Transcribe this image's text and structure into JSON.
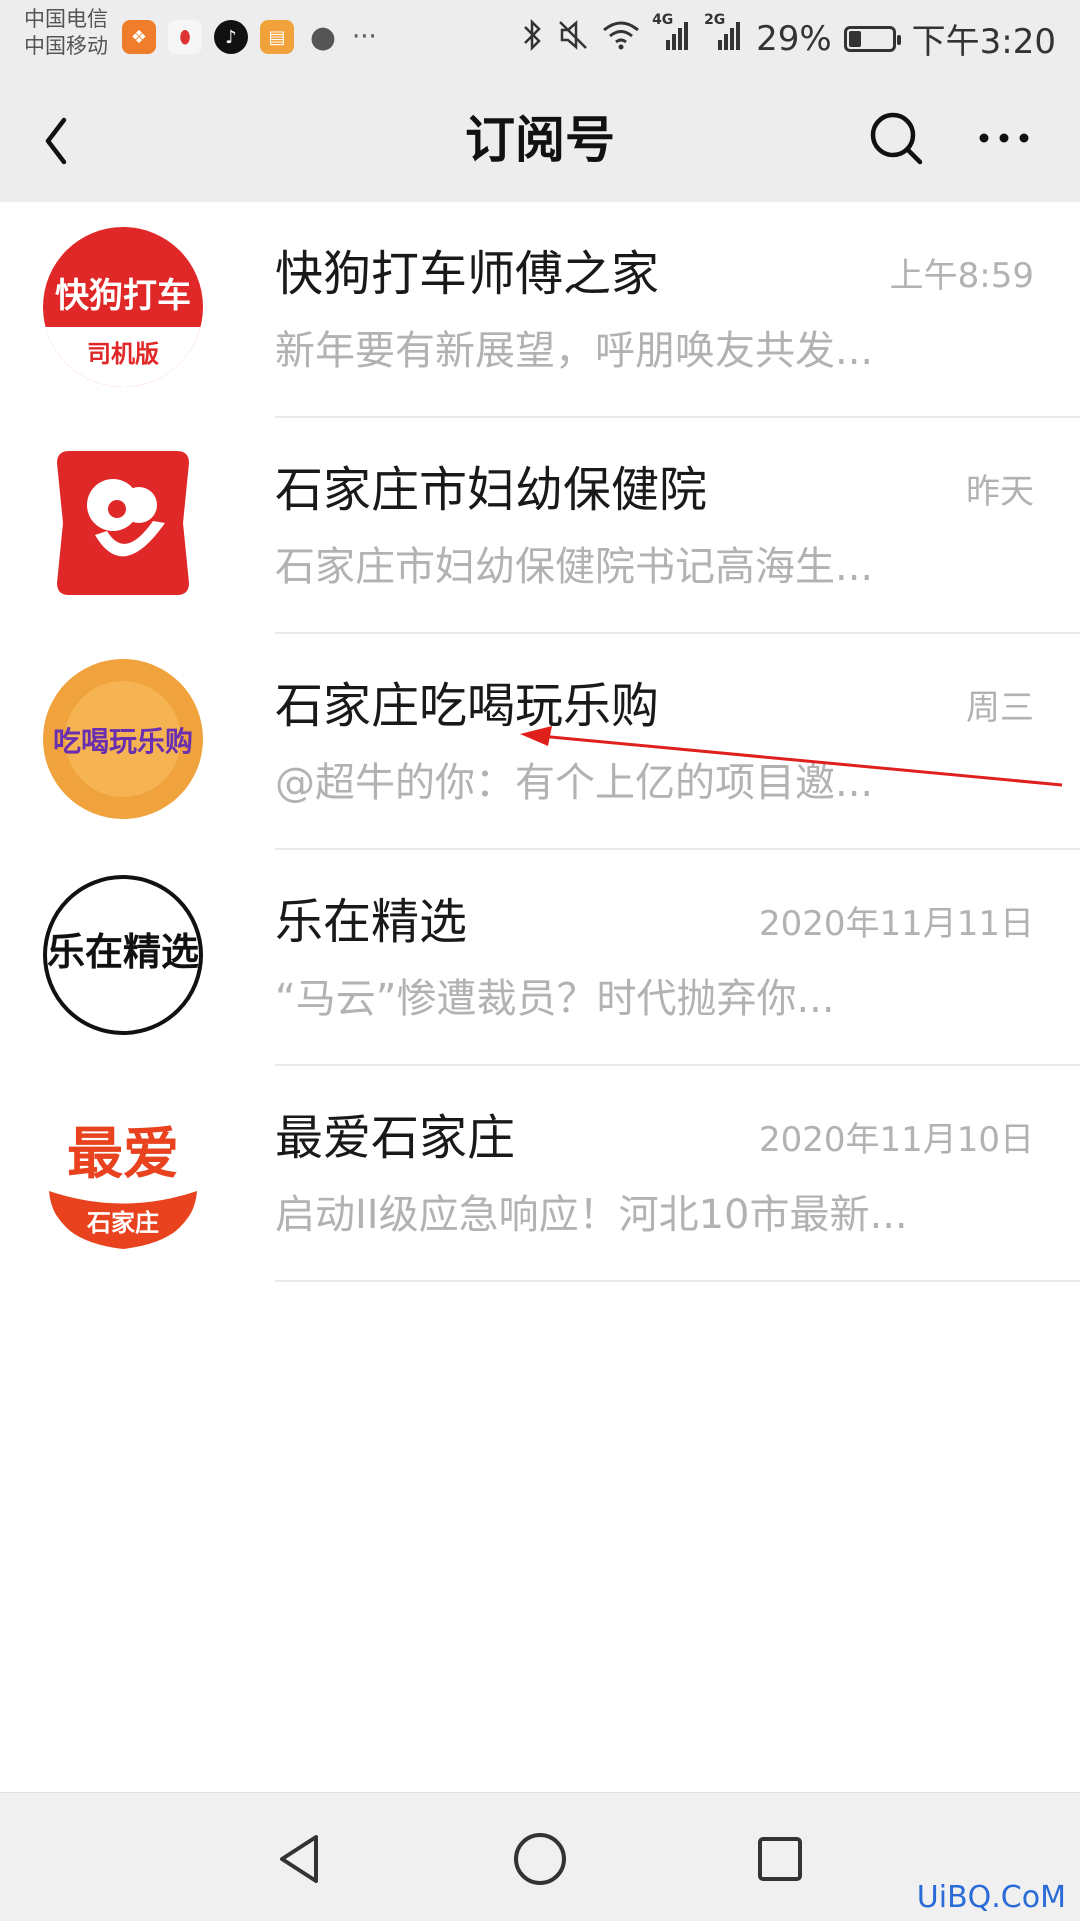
{
  "status_bar": {
    "carrier_line1": "中国电信",
    "carrier_line2": "中国移动",
    "notification_icons": [
      "app-icon-orange",
      "app-icon-map",
      "tiktok-icon",
      "app-icon-tools",
      "chat-bubble-icon",
      "more-notifications"
    ],
    "network_4g": "4G",
    "network_2g": "2G",
    "battery_percent": "29%",
    "battery_level": 0.29,
    "time": "下午3:20"
  },
  "header": {
    "title": "订阅号"
  },
  "subscriptions": [
    {
      "name": "快狗打车师傅之家",
      "time": "上午8:59",
      "preview": "新年要有新展望，呼朋唤友共发...",
      "avatar_text": "快狗打车",
      "avatar_subtext": "司机版",
      "accent": "#e02828"
    },
    {
      "name": "石家庄市妇幼保健院",
      "time": "昨天",
      "preview": "石家庄市妇幼保健院书记高海生...",
      "accent": "#e02828"
    },
    {
      "name": "石家庄吃喝玩乐购",
      "time": "周三",
      "preview": "@超牛的你：有个上亿的项目邀...",
      "avatar_text": "吃喝玩乐购",
      "accent": "#f0a23c"
    },
    {
      "name": "乐在精选",
      "time": "2020年11月11日",
      "preview": "“马云”惨遭裁员？时代抛弃你...",
      "avatar_text": "乐在精选",
      "accent": "#111111"
    },
    {
      "name": "最爱石家庄",
      "time": "2020年11月10日",
      "preview": "启动II级应急响应！河北10市最新...",
      "avatar_text": "最爱",
      "avatar_subtext": "石家庄",
      "accent": "#e8421f"
    }
  ],
  "navigation": {
    "back": "back-triangle-icon",
    "home": "home-circle-icon",
    "recents": "recents-square-icon"
  },
  "watermark": "UiBQ.CoM",
  "colors": {
    "header_bg": "#ededed",
    "annotation_arrow": "#e0201c"
  }
}
